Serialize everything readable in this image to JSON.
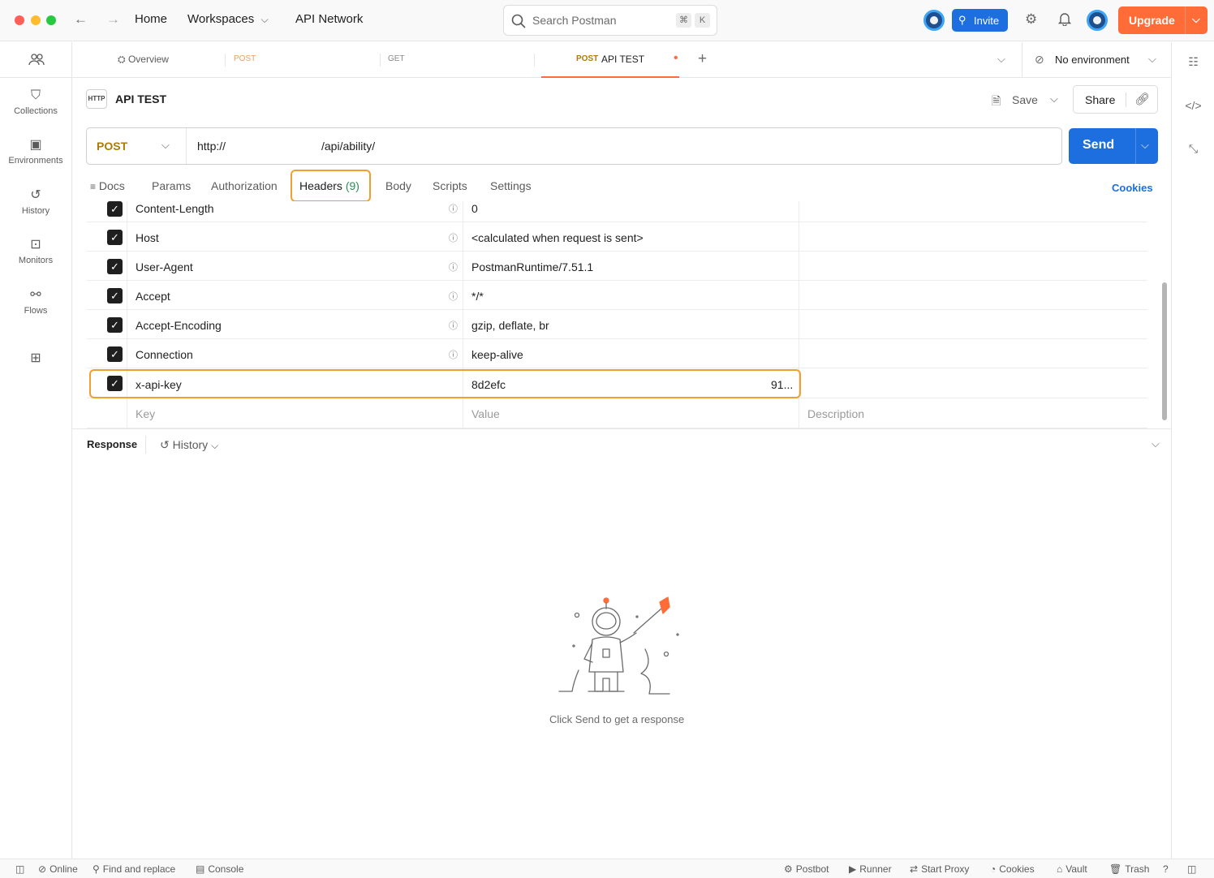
{
  "topbar": {
    "nav": [
      "Home",
      "Workspaces",
      "API Network"
    ],
    "search_placeholder": "Search Postman",
    "search_shortcut": [
      "⌘",
      "K"
    ],
    "invite_label": "Invite",
    "upgrade_label": "Upgrade"
  },
  "sidebar": {
    "items": [
      {
        "label": "Collections",
        "icon": "collections-icon"
      },
      {
        "label": "Environments",
        "icon": "environments-icon"
      },
      {
        "label": "History",
        "icon": "history-icon"
      },
      {
        "label": "Monitors",
        "icon": "monitors-icon"
      },
      {
        "label": "Flows",
        "icon": "flows-icon"
      }
    ]
  },
  "tabs": {
    "overview": "Overview",
    "tab2_method": "POST",
    "tab3_method": "GET",
    "active_method": "POST",
    "active_name": "API TEST",
    "environment": "No environment"
  },
  "request": {
    "name": "API TEST",
    "http_badge": "HTTP",
    "save_label": "Save",
    "share_label": "Share",
    "method": "POST",
    "url_part1": "http://",
    "url_part2": "/api/ability/",
    "send_label": "Send",
    "subtabs": {
      "docs": "Docs",
      "params": "Params",
      "authorization": "Authorization",
      "headers": "Headers",
      "headers_count": "(9)",
      "body": "Body",
      "scripts": "Scripts",
      "settings": "Settings"
    },
    "cookies_label": "Cookies"
  },
  "headers_table": {
    "rows": [
      {
        "key": "Content-Length",
        "value": "0"
      },
      {
        "key": "Host",
        "value": "<calculated when request is sent>"
      },
      {
        "key": "User-Agent",
        "value": "PostmanRuntime/7.51.1"
      },
      {
        "key": "Accept",
        "value": "*/*"
      },
      {
        "key": "Accept-Encoding",
        "value": "gzip, deflate, br"
      },
      {
        "key": "Connection",
        "value": "keep-alive"
      }
    ],
    "custom_row": {
      "key": "x-api-key",
      "value_start": "8d2efc",
      "value_end": "91..."
    },
    "placeholder": {
      "key": "Key",
      "value": "Value",
      "description": "Description"
    }
  },
  "response": {
    "title": "Response",
    "history_label": "History",
    "empty_message": "Click Send to get a response"
  },
  "statusbar": {
    "online": "Online",
    "find_replace": "Find and replace",
    "console": "Console",
    "postbot": "Postbot",
    "runner": "Runner",
    "start_proxy": "Start Proxy",
    "cookies": "Cookies",
    "vault": "Vault",
    "trash": "Trash"
  },
  "colors": {
    "accent": "#ff6c37",
    "primary": "#1d6fe0",
    "post_method": "#ad7a03",
    "highlight": "#f0a030"
  }
}
